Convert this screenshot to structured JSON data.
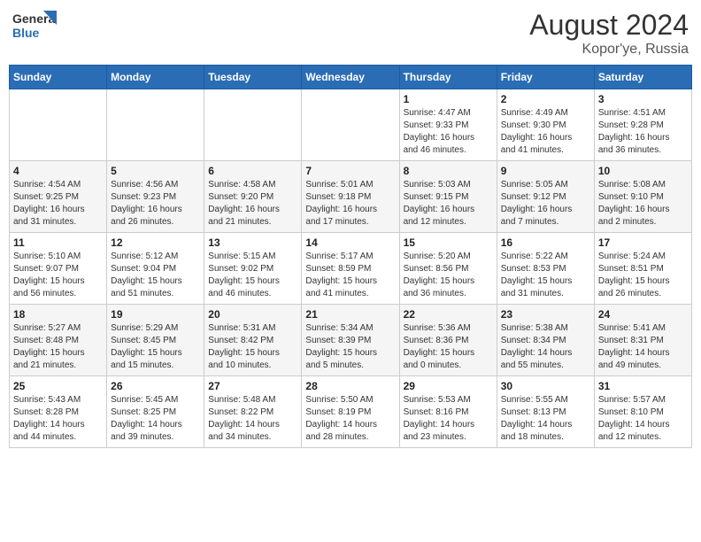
{
  "logo": {
    "line1": "General",
    "line2": "Blue"
  },
  "title": "August 2024",
  "location": "Kopor'ye, Russia",
  "days_of_week": [
    "Sunday",
    "Monday",
    "Tuesday",
    "Wednesday",
    "Thursday",
    "Friday",
    "Saturday"
  ],
  "weeks": [
    [
      {
        "day": "",
        "info": ""
      },
      {
        "day": "",
        "info": ""
      },
      {
        "day": "",
        "info": ""
      },
      {
        "day": "",
        "info": ""
      },
      {
        "day": "1",
        "info": "Sunrise: 4:47 AM\nSunset: 9:33 PM\nDaylight: 16 hours\nand 46 minutes."
      },
      {
        "day": "2",
        "info": "Sunrise: 4:49 AM\nSunset: 9:30 PM\nDaylight: 16 hours\nand 41 minutes."
      },
      {
        "day": "3",
        "info": "Sunrise: 4:51 AM\nSunset: 9:28 PM\nDaylight: 16 hours\nand 36 minutes."
      }
    ],
    [
      {
        "day": "4",
        "info": "Sunrise: 4:54 AM\nSunset: 9:25 PM\nDaylight: 16 hours\nand 31 minutes."
      },
      {
        "day": "5",
        "info": "Sunrise: 4:56 AM\nSunset: 9:23 PM\nDaylight: 16 hours\nand 26 minutes."
      },
      {
        "day": "6",
        "info": "Sunrise: 4:58 AM\nSunset: 9:20 PM\nDaylight: 16 hours\nand 21 minutes."
      },
      {
        "day": "7",
        "info": "Sunrise: 5:01 AM\nSunset: 9:18 PM\nDaylight: 16 hours\nand 17 minutes."
      },
      {
        "day": "8",
        "info": "Sunrise: 5:03 AM\nSunset: 9:15 PM\nDaylight: 16 hours\nand 12 minutes."
      },
      {
        "day": "9",
        "info": "Sunrise: 5:05 AM\nSunset: 9:12 PM\nDaylight: 16 hours\nand 7 minutes."
      },
      {
        "day": "10",
        "info": "Sunrise: 5:08 AM\nSunset: 9:10 PM\nDaylight: 16 hours\nand 2 minutes."
      }
    ],
    [
      {
        "day": "11",
        "info": "Sunrise: 5:10 AM\nSunset: 9:07 PM\nDaylight: 15 hours\nand 56 minutes."
      },
      {
        "day": "12",
        "info": "Sunrise: 5:12 AM\nSunset: 9:04 PM\nDaylight: 15 hours\nand 51 minutes."
      },
      {
        "day": "13",
        "info": "Sunrise: 5:15 AM\nSunset: 9:02 PM\nDaylight: 15 hours\nand 46 minutes."
      },
      {
        "day": "14",
        "info": "Sunrise: 5:17 AM\nSunset: 8:59 PM\nDaylight: 15 hours\nand 41 minutes."
      },
      {
        "day": "15",
        "info": "Sunrise: 5:20 AM\nSunset: 8:56 PM\nDaylight: 15 hours\nand 36 minutes."
      },
      {
        "day": "16",
        "info": "Sunrise: 5:22 AM\nSunset: 8:53 PM\nDaylight: 15 hours\nand 31 minutes."
      },
      {
        "day": "17",
        "info": "Sunrise: 5:24 AM\nSunset: 8:51 PM\nDaylight: 15 hours\nand 26 minutes."
      }
    ],
    [
      {
        "day": "18",
        "info": "Sunrise: 5:27 AM\nSunset: 8:48 PM\nDaylight: 15 hours\nand 21 minutes."
      },
      {
        "day": "19",
        "info": "Sunrise: 5:29 AM\nSunset: 8:45 PM\nDaylight: 15 hours\nand 15 minutes."
      },
      {
        "day": "20",
        "info": "Sunrise: 5:31 AM\nSunset: 8:42 PM\nDaylight: 15 hours\nand 10 minutes."
      },
      {
        "day": "21",
        "info": "Sunrise: 5:34 AM\nSunset: 8:39 PM\nDaylight: 15 hours\nand 5 minutes."
      },
      {
        "day": "22",
        "info": "Sunrise: 5:36 AM\nSunset: 8:36 PM\nDaylight: 15 hours\nand 0 minutes."
      },
      {
        "day": "23",
        "info": "Sunrise: 5:38 AM\nSunset: 8:34 PM\nDaylight: 14 hours\nand 55 minutes."
      },
      {
        "day": "24",
        "info": "Sunrise: 5:41 AM\nSunset: 8:31 PM\nDaylight: 14 hours\nand 49 minutes."
      }
    ],
    [
      {
        "day": "25",
        "info": "Sunrise: 5:43 AM\nSunset: 8:28 PM\nDaylight: 14 hours\nand 44 minutes."
      },
      {
        "day": "26",
        "info": "Sunrise: 5:45 AM\nSunset: 8:25 PM\nDaylight: 14 hours\nand 39 minutes."
      },
      {
        "day": "27",
        "info": "Sunrise: 5:48 AM\nSunset: 8:22 PM\nDaylight: 14 hours\nand 34 minutes."
      },
      {
        "day": "28",
        "info": "Sunrise: 5:50 AM\nSunset: 8:19 PM\nDaylight: 14 hours\nand 28 minutes."
      },
      {
        "day": "29",
        "info": "Sunrise: 5:53 AM\nSunset: 8:16 PM\nDaylight: 14 hours\nand 23 minutes."
      },
      {
        "day": "30",
        "info": "Sunrise: 5:55 AM\nSunset: 8:13 PM\nDaylight: 14 hours\nand 18 minutes."
      },
      {
        "day": "31",
        "info": "Sunrise: 5:57 AM\nSunset: 8:10 PM\nDaylight: 14 hours\nand 12 minutes."
      }
    ]
  ]
}
